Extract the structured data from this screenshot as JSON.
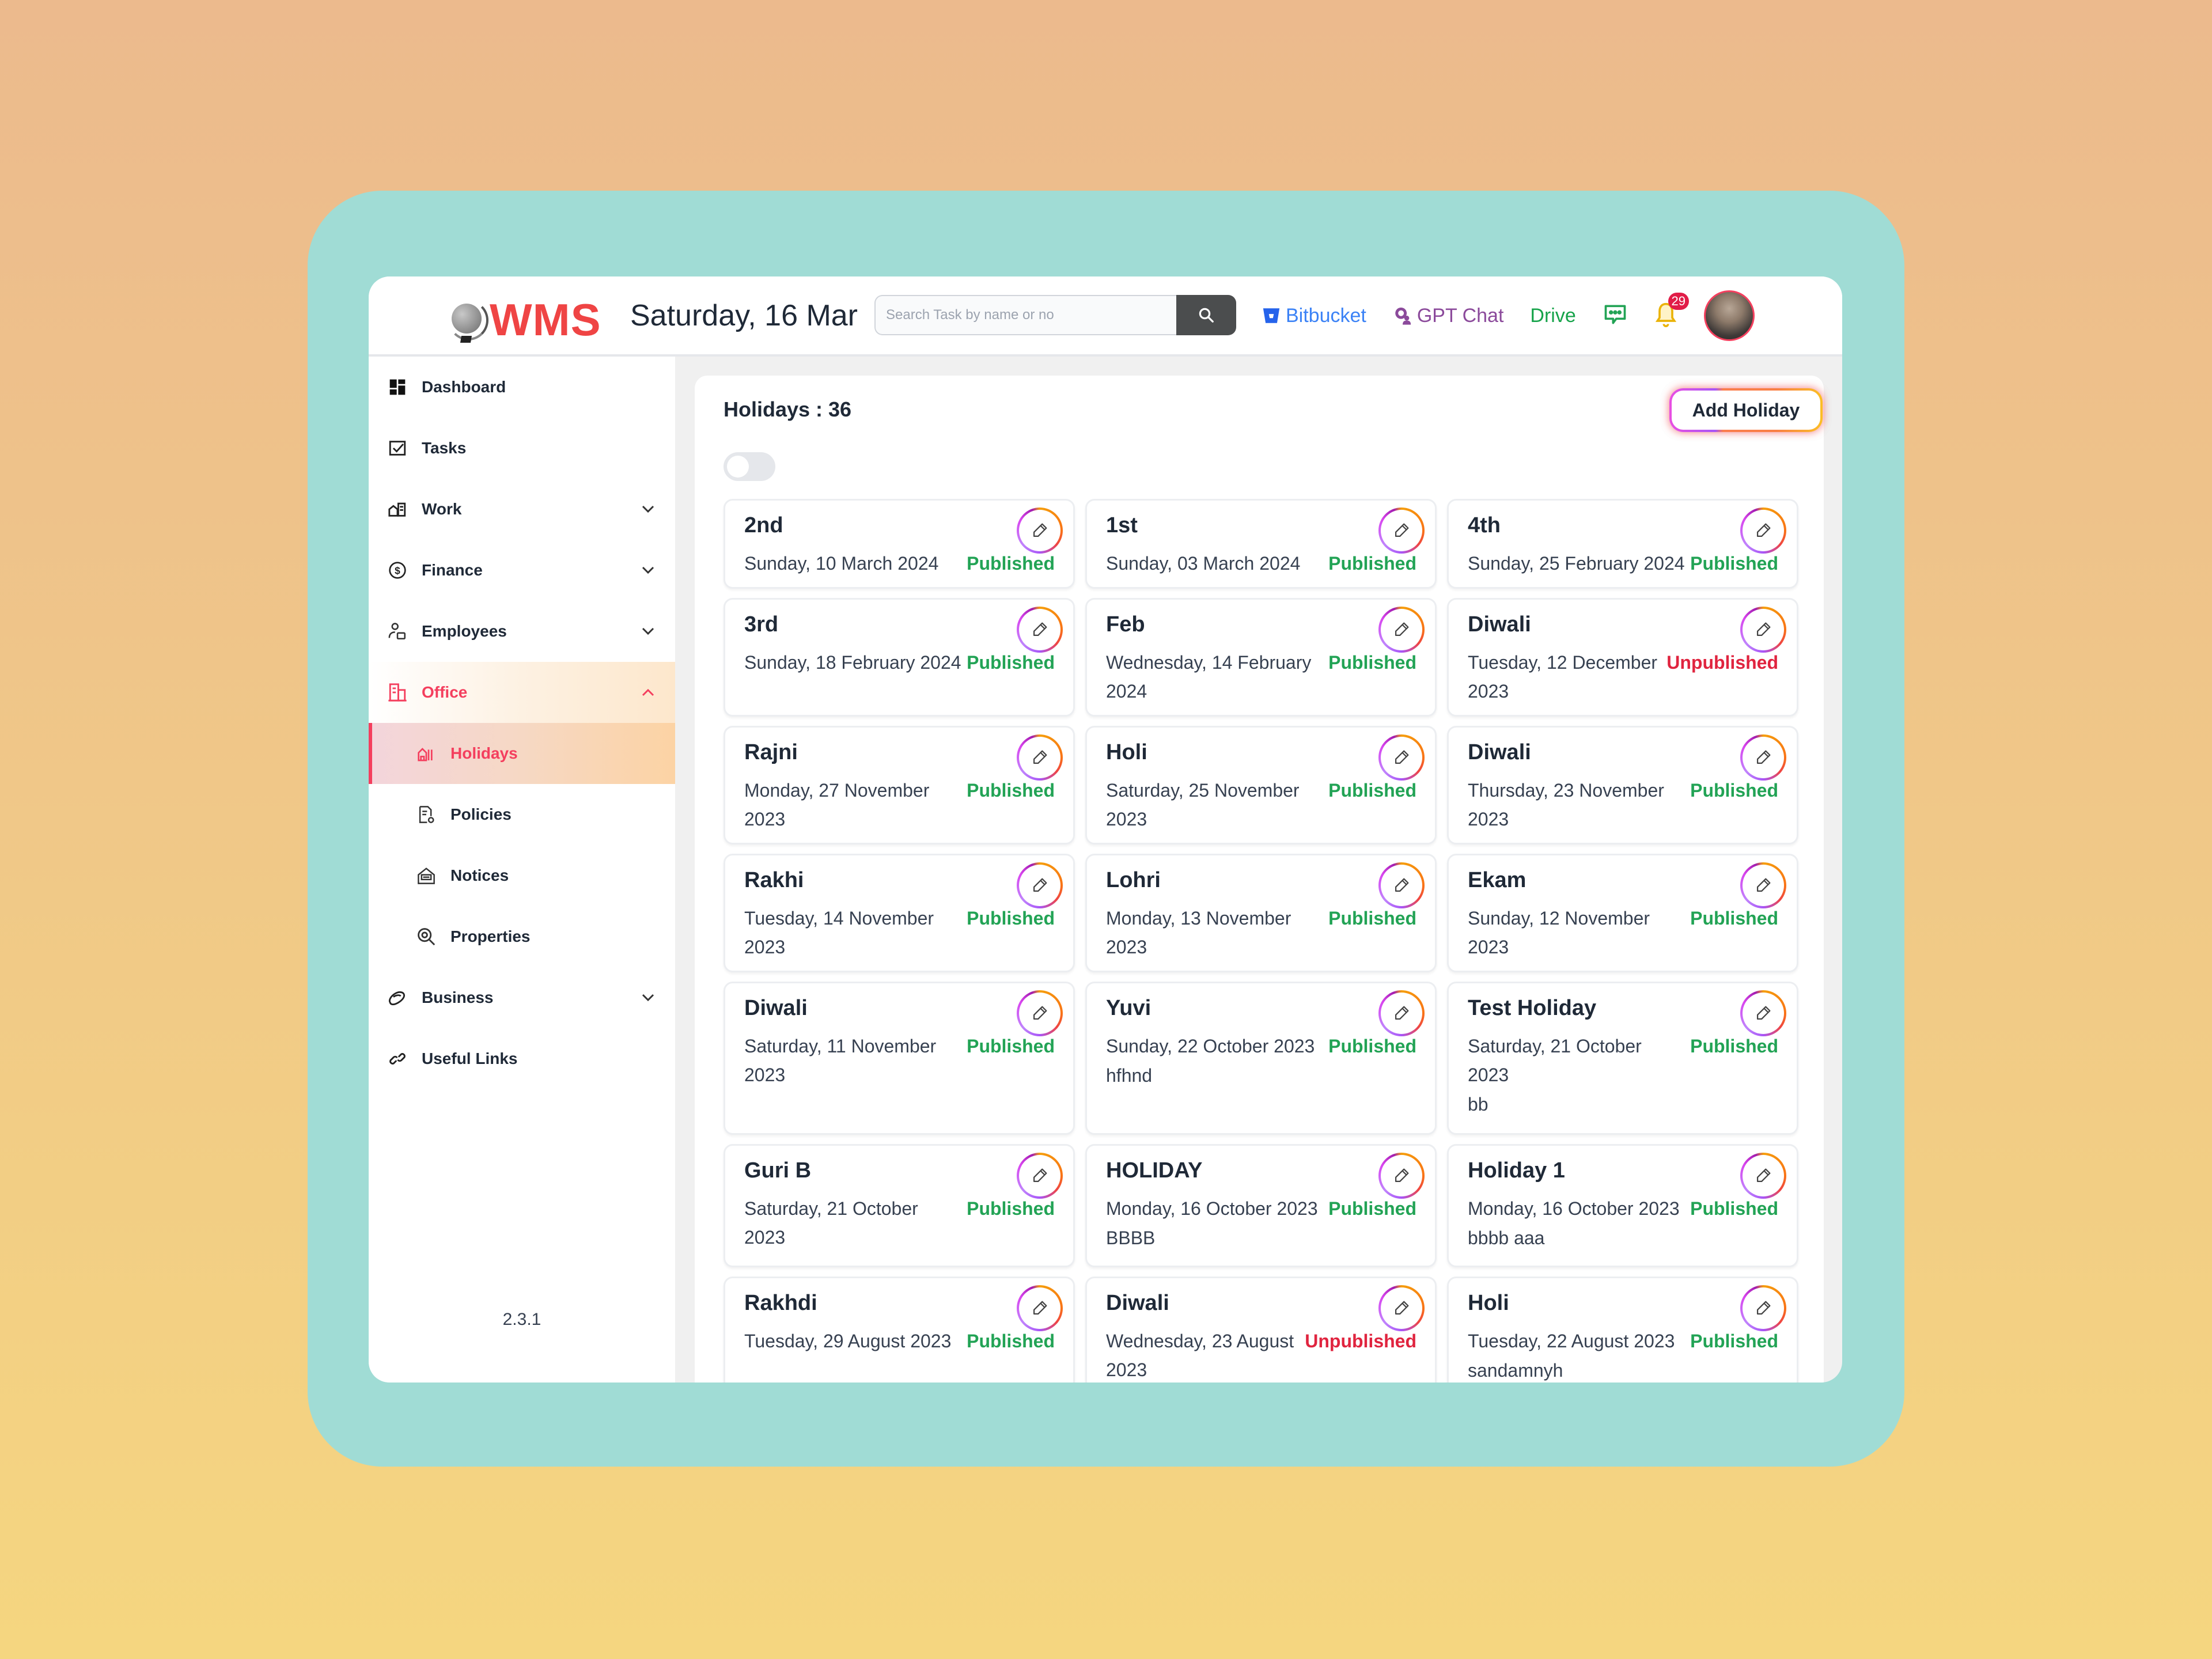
{
  "app": {
    "logo_text": "WMS",
    "current_date": "Saturday, 16 Mar",
    "version": "2.3.1",
    "brand_color": "#ef4444",
    "accent_color": "#f43f5e"
  },
  "header": {
    "search": {
      "placeholder": "Search Task by name or no",
      "value": "",
      "button_icon": "search-icon"
    },
    "links": [
      {
        "label": "Bitbucket",
        "icon": "bitbucket-icon",
        "color": "#3b82f6"
      },
      {
        "label": "GPT Chat",
        "icon": "gpt-chat-icon",
        "color": "#8b4a9b"
      },
      {
        "label": "Drive",
        "icon": "",
        "color": "#16a34a"
      }
    ],
    "chat_icon": "chat-bubble-icon",
    "notifications": {
      "icon": "bell-icon",
      "count": "29"
    },
    "avatar": "user-avatar"
  },
  "sidebar": {
    "items": [
      {
        "label": "Dashboard",
        "icon": "dashboard-icon",
        "expandable": false
      },
      {
        "label": "Tasks",
        "icon": "tasks-checkbox-icon",
        "expandable": false
      },
      {
        "label": "Work",
        "icon": "work-icon",
        "expandable": true,
        "expanded": false
      },
      {
        "label": "Finance",
        "icon": "dollar-circle-icon",
        "expandable": true,
        "expanded": false
      },
      {
        "label": "Employees",
        "icon": "employees-icon",
        "expandable": true,
        "expanded": false
      },
      {
        "label": "Office",
        "icon": "office-building-icon",
        "expandable": true,
        "expanded": true,
        "children": [
          {
            "label": "Holidays",
            "icon": "holidays-icon",
            "active": true
          },
          {
            "label": "Policies",
            "icon": "policies-icon"
          },
          {
            "label": "Notices",
            "icon": "notices-icon"
          },
          {
            "label": "Properties",
            "icon": "properties-search-icon"
          }
        ]
      },
      {
        "label": "Business",
        "icon": "business-icon",
        "expandable": true,
        "expanded": false
      },
      {
        "label": "Useful Links",
        "icon": "link-icon",
        "expandable": false
      }
    ]
  },
  "main": {
    "title": "Holidays : 36",
    "add_button_label": "Add Holiday",
    "toggle_on": false,
    "status_colors": {
      "Published": "#22a355",
      "Unpublished": "#e0243f"
    },
    "holidays": [
      {
        "name": "2nd",
        "date": "Sunday, 10 March 2024",
        "status": "Published",
        "description": ""
      },
      {
        "name": "1st",
        "date": "Sunday, 03 March 2024",
        "status": "Published",
        "description": ""
      },
      {
        "name": "4th",
        "date": "Sunday, 25 February 2024",
        "status": "Published",
        "description": ""
      },
      {
        "name": "3rd",
        "date": "Sunday, 18 February 2024",
        "status": "Published",
        "description": ""
      },
      {
        "name": "Feb",
        "date": "Wednesday, 14 February 2024",
        "status": "Published",
        "description": ""
      },
      {
        "name": "Diwali",
        "date": "Tuesday, 12 December 2023",
        "status": "Unpublished",
        "description": ""
      },
      {
        "name": "Rajni",
        "date": "Monday, 27 November 2023",
        "status": "Published",
        "description": ""
      },
      {
        "name": "Holi",
        "date": "Saturday, 25 November 2023",
        "status": "Published",
        "description": ""
      },
      {
        "name": "Diwali",
        "date": "Thursday, 23 November 2023",
        "status": "Published",
        "description": ""
      },
      {
        "name": "Rakhi",
        "date": "Tuesday, 14 November 2023",
        "status": "Published",
        "description": ""
      },
      {
        "name": "Lohri",
        "date": "Monday, 13 November 2023",
        "status": "Published",
        "description": ""
      },
      {
        "name": "Ekam",
        "date": "Sunday, 12 November 2023",
        "status": "Published",
        "description": ""
      },
      {
        "name": "Diwali",
        "date": "Saturday, 11 November 2023",
        "status": "Published",
        "description": ""
      },
      {
        "name": "Yuvi",
        "date": "Sunday, 22 October 2023",
        "status": "Published",
        "description": "hfhnd"
      },
      {
        "name": "Test Holiday",
        "date": "Saturday, 21 October 2023",
        "status": "Published",
        "description": "bb"
      },
      {
        "name": "Guri B",
        "date": "Saturday, 21 October 2023",
        "status": "Published",
        "description": ""
      },
      {
        "name": "HOLIDAY",
        "date": "Monday, 16 October 2023",
        "status": "Published",
        "description": "BBBB"
      },
      {
        "name": "Holiday 1",
        "date": "Monday, 16 October 2023",
        "status": "Published",
        "description": "bbbb aaa"
      },
      {
        "name": "Rakhdi",
        "date": "Tuesday, 29 August 2023",
        "status": "Published",
        "description": ""
      },
      {
        "name": "Diwali",
        "date": "Wednesday, 23 August 2023",
        "status": "Unpublished",
        "description": ""
      },
      {
        "name": "Holi",
        "date": "Tuesday, 22 August 2023",
        "status": "Published",
        "description": "sandamnyh"
      }
    ]
  }
}
